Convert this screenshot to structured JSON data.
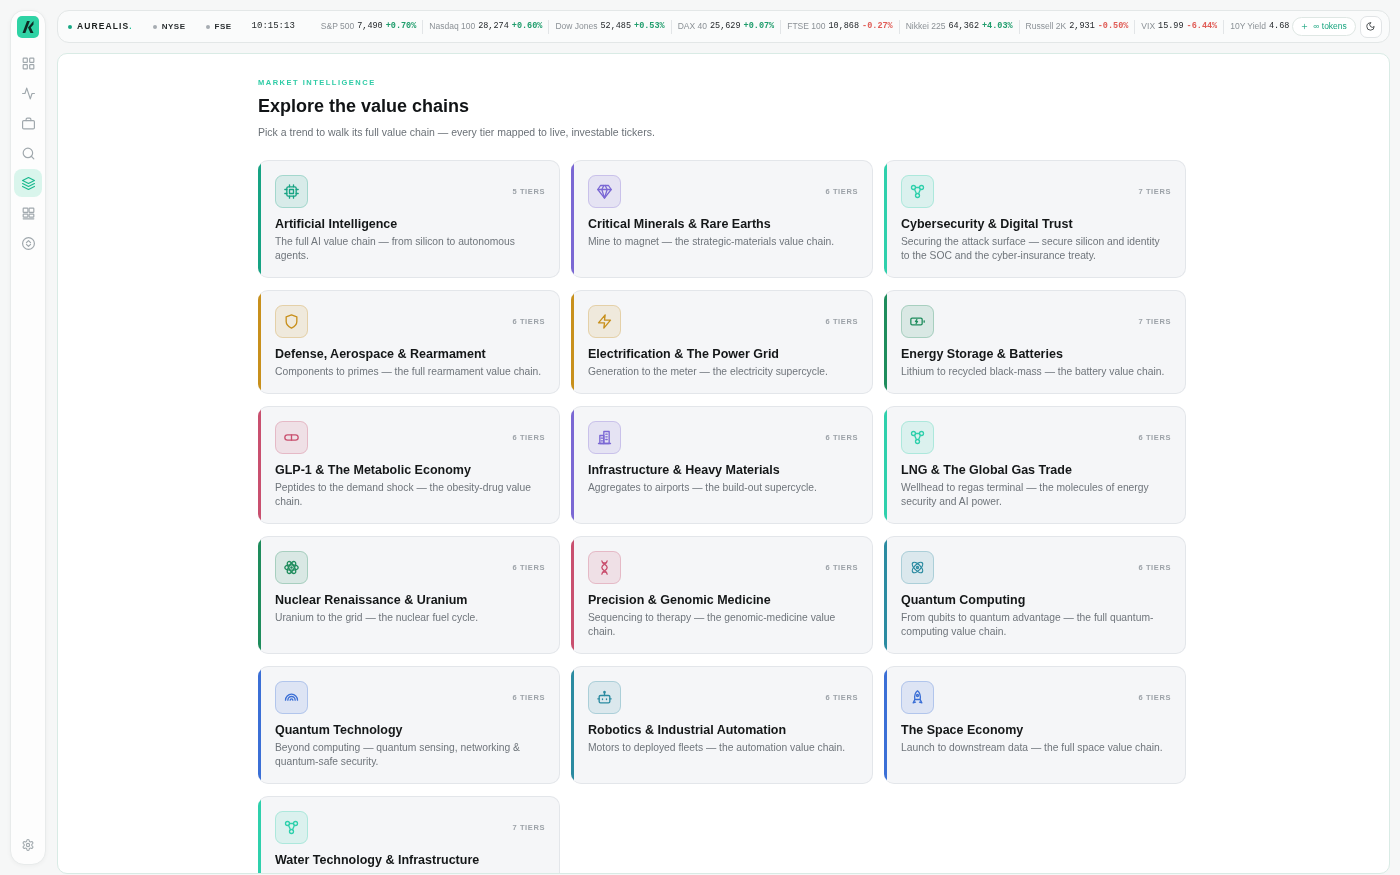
{
  "sidebar": {
    "nav": [
      {
        "selected": false
      },
      {
        "selected": false
      },
      {
        "selected": false
      },
      {
        "selected": false
      },
      {
        "selected": true
      },
      {
        "selected": false
      },
      {
        "selected": false
      }
    ]
  },
  "topbar": {
    "brand": {
      "name": "AUREALIS",
      "suffix": ".",
      "live": true
    },
    "markets": [
      {
        "name": "NYSE",
        "open": false
      },
      {
        "name": "FSE",
        "open": false
      }
    ],
    "clock": "10:15:13",
    "tickers": [
      {
        "name": "S&P 500",
        "value": "7,490",
        "change": "+0.70%",
        "color": "#1f9d6c"
      },
      {
        "name": "Nasdaq 100",
        "value": "28,274",
        "change": "+0.60%",
        "color": "#1f9d6c"
      },
      {
        "name": "Dow Jones",
        "value": "52,485",
        "change": "+0.53%",
        "color": "#1f9d6c"
      },
      {
        "name": "DAX 40",
        "value": "25,629",
        "change": "+0.07%",
        "color": "#1f9d6c"
      },
      {
        "name": "FTSE 100",
        "value": "10,868",
        "change": "-0.27%",
        "color": "#e05d57"
      },
      {
        "name": "Nikkei 225",
        "value": "64,362",
        "change": "+4.03%",
        "color": "#1f9d6c"
      },
      {
        "name": "Russell 2K",
        "value": "2,931",
        "change": "-0.50%",
        "color": "#e05d57"
      },
      {
        "name": "VIX",
        "value": "15.99",
        "change": "-6.44%",
        "color": "#e05d57"
      },
      {
        "name": "10Y Yield",
        "value": "4.68"
      }
    ],
    "tokens_button": {
      "label": "∞ tokens"
    }
  },
  "page": {
    "eyebrow": "MARKET INTELLIGENCE",
    "title": "Explore the value chains",
    "subtitle": "Pick a trend to walk its full value chain — every tier mapped to live, investable tickers."
  },
  "cards": [
    {
      "title": "Artificial Intelligence",
      "description": "The full AI value chain — from silicon to autonomous agents.",
      "tiers": "5 TIERS",
      "color": "#16a383"
    },
    {
      "title": "Critical Minerals & Rare Earths",
      "description": "Mine to magnet — the strategic-materials value chain.",
      "tiers": "6 TIERS",
      "color": "#7b68d4"
    },
    {
      "title": "Cybersecurity & Digital Trust",
      "description": "Securing the attack surface — secure silicon and identity to the SOC and the cyber-insurance treaty.",
      "tiers": "7 TIERS",
      "color": "#2fd0ac"
    },
    {
      "title": "Defense, Aerospace & Rearmament",
      "description": "Components to primes — the full rearmament value chain.",
      "tiers": "6 TIERS",
      "color": "#c8901c"
    },
    {
      "title": "Electrification & The Power Grid",
      "description": "Generation to the meter — the electricity supercycle.",
      "tiers": "6 TIERS",
      "color": "#c8901c"
    },
    {
      "title": "Energy Storage & Batteries",
      "description": "Lithium to recycled black-mass — the battery value chain.",
      "tiers": "7 TIERS",
      "color": "#1e8c5c"
    },
    {
      "title": "GLP-1 & The Metabolic Economy",
      "description": "Peptides to the demand shock — the obesity-drug value chain.",
      "tiers": "6 TIERS",
      "color": "#c9506f"
    },
    {
      "title": "Infrastructure & Heavy Materials",
      "description": "Aggregates to airports — the build-out supercycle.",
      "tiers": "6 TIERS",
      "color": "#7b68d4"
    },
    {
      "title": "LNG & The Global Gas Trade",
      "description": "Wellhead to regas terminal — the molecules of energy security and AI power.",
      "tiers": "6 TIERS",
      "color": "#2fd0ac"
    },
    {
      "title": "Nuclear Renaissance & Uranium",
      "description": "Uranium to the grid — the nuclear fuel cycle.",
      "tiers": "6 TIERS",
      "color": "#1e8c5c"
    },
    {
      "title": "Precision & Genomic Medicine",
      "description": "Sequencing to therapy — the genomic-medicine value chain.",
      "tiers": "6 TIERS",
      "color": "#c9506f"
    },
    {
      "title": "Quantum Computing",
      "description": "From qubits to quantum advantage — the full quantum-computing value chain.",
      "tiers": "6 TIERS",
      "color": "#2b8ba1"
    },
    {
      "title": "Quantum Technology",
      "description": "Beyond computing — quantum sensing, networking & quantum-safe security.",
      "tiers": "6 TIERS",
      "color": "#3b6fd6"
    },
    {
      "title": "Robotics & Industrial Automation",
      "description": "Motors to deployed fleets — the automation value chain.",
      "tiers": "6 TIERS",
      "color": "#2b8ba1"
    },
    {
      "title": "The Space Economy",
      "description": "Launch to downstream data — the full space value chain.",
      "tiers": "6 TIERS",
      "color": "#3b6fd6"
    },
    {
      "title": "Water Technology & Infrastructure",
      "tiers": "7 TIERS",
      "color": "#2fd0ac"
    }
  ]
}
